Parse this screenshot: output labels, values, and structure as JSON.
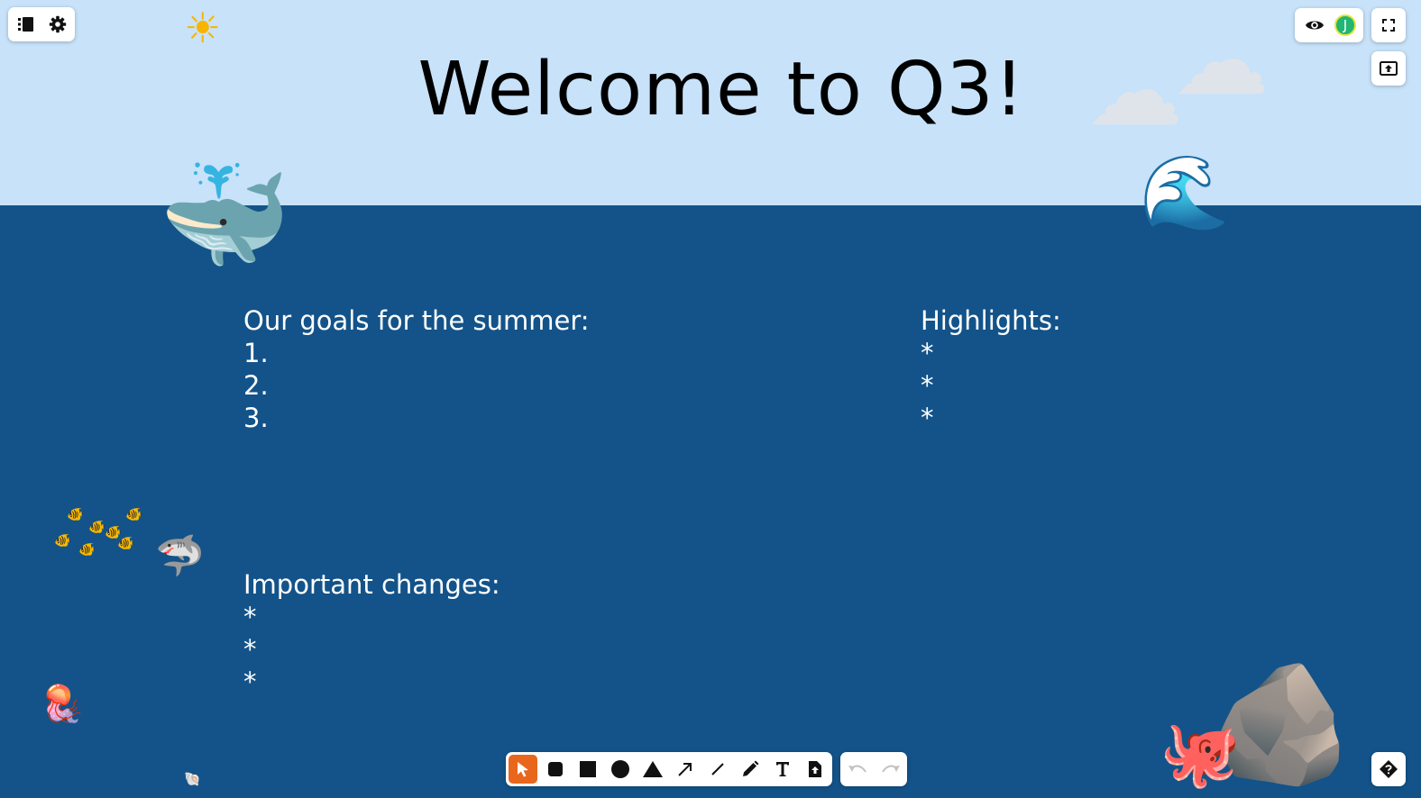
{
  "board": {
    "title": "Welcome to Q3!",
    "colors": {
      "sky": "#c7e2f9",
      "sea": "#135389",
      "accent": "#e8671c"
    },
    "goals": {
      "heading": "Our goals for the summer:",
      "items": [
        "1.",
        "2.",
        "3."
      ]
    },
    "highlights": {
      "heading": "Highlights:",
      "items": [
        "*",
        "*",
        "*"
      ]
    },
    "changes": {
      "heading": "Important changes:",
      "items": [
        "*",
        "*",
        "*"
      ]
    },
    "stickers": {
      "sun": "☀",
      "cloud": "☁",
      "whale": "🐳",
      "wave": "🌊",
      "fish": "🐠",
      "shark": "🦈",
      "jellyfish": "🪼",
      "shell": "🐚",
      "octopus": "🐙",
      "rock": "🪨"
    }
  },
  "toolbar_top_left": {
    "icons": [
      "list-icon",
      "gear-icon"
    ]
  },
  "toolbar_top_right": {
    "icons": [
      "eye-icon",
      "fullscreen-icon",
      "export-icon"
    ],
    "avatar_initial": "J"
  },
  "toolbar_bottom": {
    "tools": [
      "select",
      "rounded-rect",
      "rectangle",
      "circle",
      "triangle",
      "arrow",
      "line",
      "pencil",
      "text",
      "upload"
    ],
    "active_tool": "select",
    "history": [
      "undo",
      "redo"
    ]
  },
  "help": {
    "icon": "help-icon"
  }
}
